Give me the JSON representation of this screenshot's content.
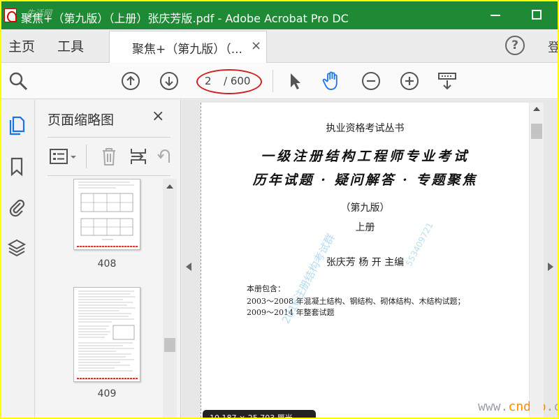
{
  "window": {
    "title": "聚焦+（第九版）（上册）张庆芳版.pdf - Adobe Acrobat Pro DC",
    "watermark": "生活网"
  },
  "menubar": {
    "home": "主页",
    "tools": "工具",
    "tab_label": "聚焦+（第九版）（...",
    "tab_close": "×",
    "help": "?",
    "login": "登"
  },
  "toolbar": {
    "page_current": "2",
    "page_total": "/ 600"
  },
  "panel": {
    "title": "页面缩略图",
    "close": "×",
    "thumbnails": [
      {
        "label": "408"
      },
      {
        "label": "409"
      }
    ]
  },
  "document": {
    "series": "执业资格考试丛书",
    "title_line1": "一级注册结构工程师专业考试",
    "title_line2": "历年试题 · 疑问解答 · 专题聚焦",
    "edition": "（第九版）",
    "volume": "上册",
    "authors": "张庆芳  杨  开  主编",
    "contents_heading": "本册包含：",
    "contents_line1": "2003～2008 年混凝土结构、钢结构、砌体结构、木结构试题；",
    "contents_line2": "2009～2014 年整套试题",
    "watermark_diag": "2016注册结构考试群",
    "watermark_diag2": "553409721",
    "site_watermark_a": "www.",
    "site_watermark_b": "cndao",
    "site_watermark_c": ".com"
  },
  "tooltip": {
    "text": "10.187 × 25.703 厘米"
  },
  "colors": {
    "titlebar": "#1f8a35",
    "border": "#ffff00",
    "annotation": "#d21f1f",
    "hand_tool": "#1a73e8"
  }
}
